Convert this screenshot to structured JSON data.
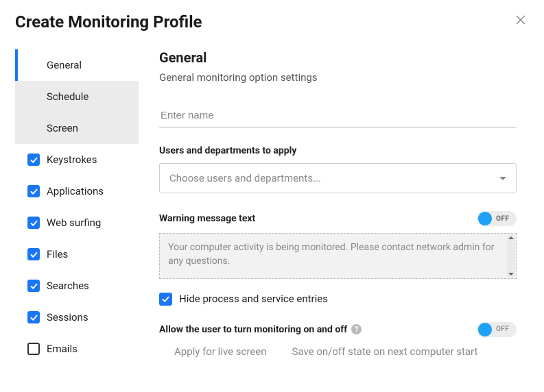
{
  "dialog": {
    "title": "Create Monitoring Profile"
  },
  "sidebar": {
    "items": [
      {
        "label": "General",
        "checked": null,
        "active": true
      },
      {
        "label": "Schedule",
        "checked": null,
        "active": false
      },
      {
        "label": "Screen",
        "checked": null,
        "active": false
      },
      {
        "label": "Keystrokes",
        "checked": true,
        "active": false
      },
      {
        "label": "Applications",
        "checked": true,
        "active": false
      },
      {
        "label": "Web surfing",
        "checked": true,
        "active": false
      },
      {
        "label": "Files",
        "checked": true,
        "active": false
      },
      {
        "label": "Searches",
        "checked": true,
        "active": false
      },
      {
        "label": "Sessions",
        "checked": true,
        "active": false
      },
      {
        "label": "Emails",
        "checked": false,
        "active": false
      }
    ]
  },
  "main": {
    "heading": "General",
    "subheading": "General monitoring option settings",
    "name_placeholder": "Enter name",
    "users_label": "Users and departments to apply",
    "users_placeholder": "Choose users and departments...",
    "warning_label": "Warning message text",
    "warning_toggle_state": "OFF",
    "warning_text": "Your computer activity is being monitored. Please contact network admin for any questions.",
    "hide_process_label": "Hide process and service entries",
    "allow_label": "Allow the user to turn monitoring on and off",
    "allow_toggle_state": "OFF",
    "apply_live_label": "Apply for live screen",
    "save_state_label": "Save on/off state on next computer start"
  }
}
